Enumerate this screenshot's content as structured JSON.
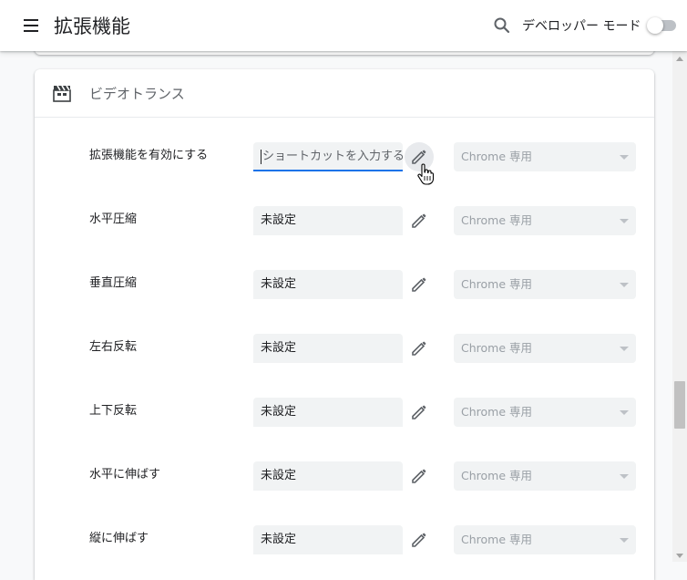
{
  "toolbar": {
    "title": "拡張機能",
    "dev_mode_label": "デベロッパー モード",
    "dev_mode_enabled": false,
    "icons": [
      "menu-icon",
      "search-icon"
    ]
  },
  "extension": {
    "name": "ビデオトランス",
    "icon": "clapperboard-icon"
  },
  "shortcuts": [
    {
      "label": "拡張機能を有効にする",
      "value": "ショートカットを入力する",
      "editing": true,
      "scope": "Chrome 専用"
    },
    {
      "label": "水平圧縮",
      "value": "未設定",
      "editing": false,
      "scope": "Chrome 専用"
    },
    {
      "label": "垂直圧縮",
      "value": "未設定",
      "editing": false,
      "scope": "Chrome 専用"
    },
    {
      "label": "左右反転",
      "value": "未設定",
      "editing": false,
      "scope": "Chrome 専用"
    },
    {
      "label": "上下反転",
      "value": "未設定",
      "editing": false,
      "scope": "Chrome 専用"
    },
    {
      "label": "水平に伸ばす",
      "value": "未設定",
      "editing": false,
      "scope": "Chrome 専用"
    },
    {
      "label": "縦に伸ばす",
      "value": "未設定",
      "editing": false,
      "scope": "Chrome 専用"
    }
  ],
  "colors": {
    "accent": "#1a73e8",
    "field_bg": "#f1f3f4",
    "page_bg": "#f8f9fa"
  }
}
